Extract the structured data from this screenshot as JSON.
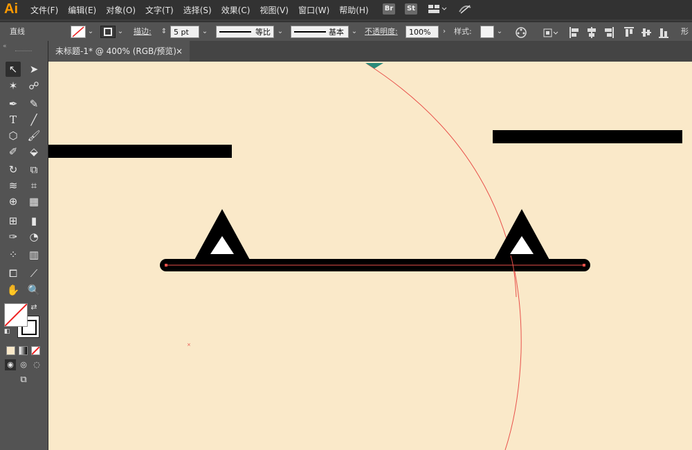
{
  "app": {
    "logo": "Ai"
  },
  "menu": [
    "文件(F)",
    "编辑(E)",
    "对象(O)",
    "文字(T)",
    "选择(S)",
    "效果(C)",
    "视图(V)",
    "窗口(W)",
    "帮助(H)"
  ],
  "apps": {
    "br": "Br",
    "st": "St"
  },
  "control": {
    "selection_label": "直线",
    "stroke_label": "描边:",
    "stroke_weight": "5 pt",
    "profile_label": "等比",
    "brush_label": "基本",
    "opacity_label": "不透明度:",
    "opacity_value": "100%",
    "style_label": "样式:",
    "shape_label": "形状"
  },
  "document": {
    "tab_title": "未标题-1* @ 400% (RGB/预览)",
    "close": "×"
  },
  "colors": {
    "canvas_bg": "#fae9c9",
    "accent": "#ff9a00",
    "guide": "#e8504a",
    "artwork": "#000000"
  }
}
